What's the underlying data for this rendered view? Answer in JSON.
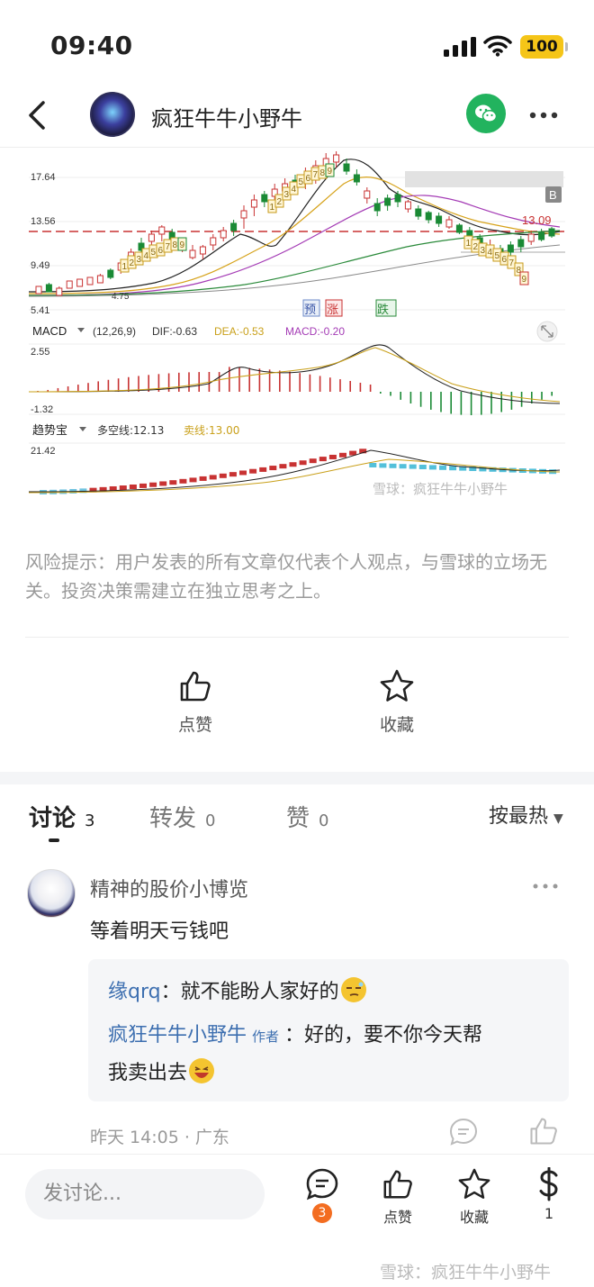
{
  "status_bar": {
    "time": "09:40",
    "battery": "100"
  },
  "nav": {
    "title": "疯狂牛牛小野牛"
  },
  "chart": {
    "price_ticks": [
      "17.64",
      "13.56",
      "9.49",
      "5.41"
    ],
    "current_price": "13.09",
    "left_low_marker": "4.75",
    "b_marker": "B",
    "signals": [
      "预",
      "涨",
      "跌"
    ],
    "macd_label": "MACD",
    "macd_params": "(12,26,9)",
    "macd_dif": "DIF:-0.63",
    "macd_dea": "DEA:-0.53",
    "macd_value": "MACD:-0.20",
    "macd_ticks": [
      "2.55",
      "-1.32"
    ],
    "trend_label": "趋势宝",
    "trend_long": "多空线:12.13",
    "trend_sell": "卖线:13.00",
    "trend_tick": "21.42",
    "watermark": "雪球：疯狂牛牛小野牛"
  },
  "risk_note": "风险提示：用户发表的所有文章仅代表个人观点，与雪球的立场无关。投资决策需建立在独立思考之上。",
  "actions": {
    "like": "点赞",
    "favorite": "收藏"
  },
  "tabs": [
    {
      "label": "讨论",
      "count": "3"
    },
    {
      "label": "转发",
      "count": "0"
    },
    {
      "label": "赞",
      "count": "0"
    }
  ],
  "sort": {
    "label": "按最热"
  },
  "comment": {
    "user": "精神的股价小博览",
    "text": "等着明天亏钱吧",
    "replies": [
      {
        "user": "缘qrq",
        "sep": "：",
        "text": "就不能盼人家好的"
      },
      {
        "user": "疯狂牛牛小野牛",
        "tag": "作者",
        "sep": "：",
        "text": "好的，要不你今天帮",
        "text2": "我卖出去"
      }
    ],
    "meta": "昨天 14:05 · 广东"
  },
  "bottom_bar": {
    "compose_placeholder": "发讨论...",
    "discuss_count": "3",
    "like": "点赞",
    "favorite": "收藏",
    "reward_count": "1",
    "watermark": "雪球：疯狂牛牛小野牛"
  },
  "colors": {
    "accent": "#f36d21",
    "up": "#c83232",
    "down": "#1a8a35",
    "link": "#3d6fb0",
    "wechat": "#22b35e"
  }
}
